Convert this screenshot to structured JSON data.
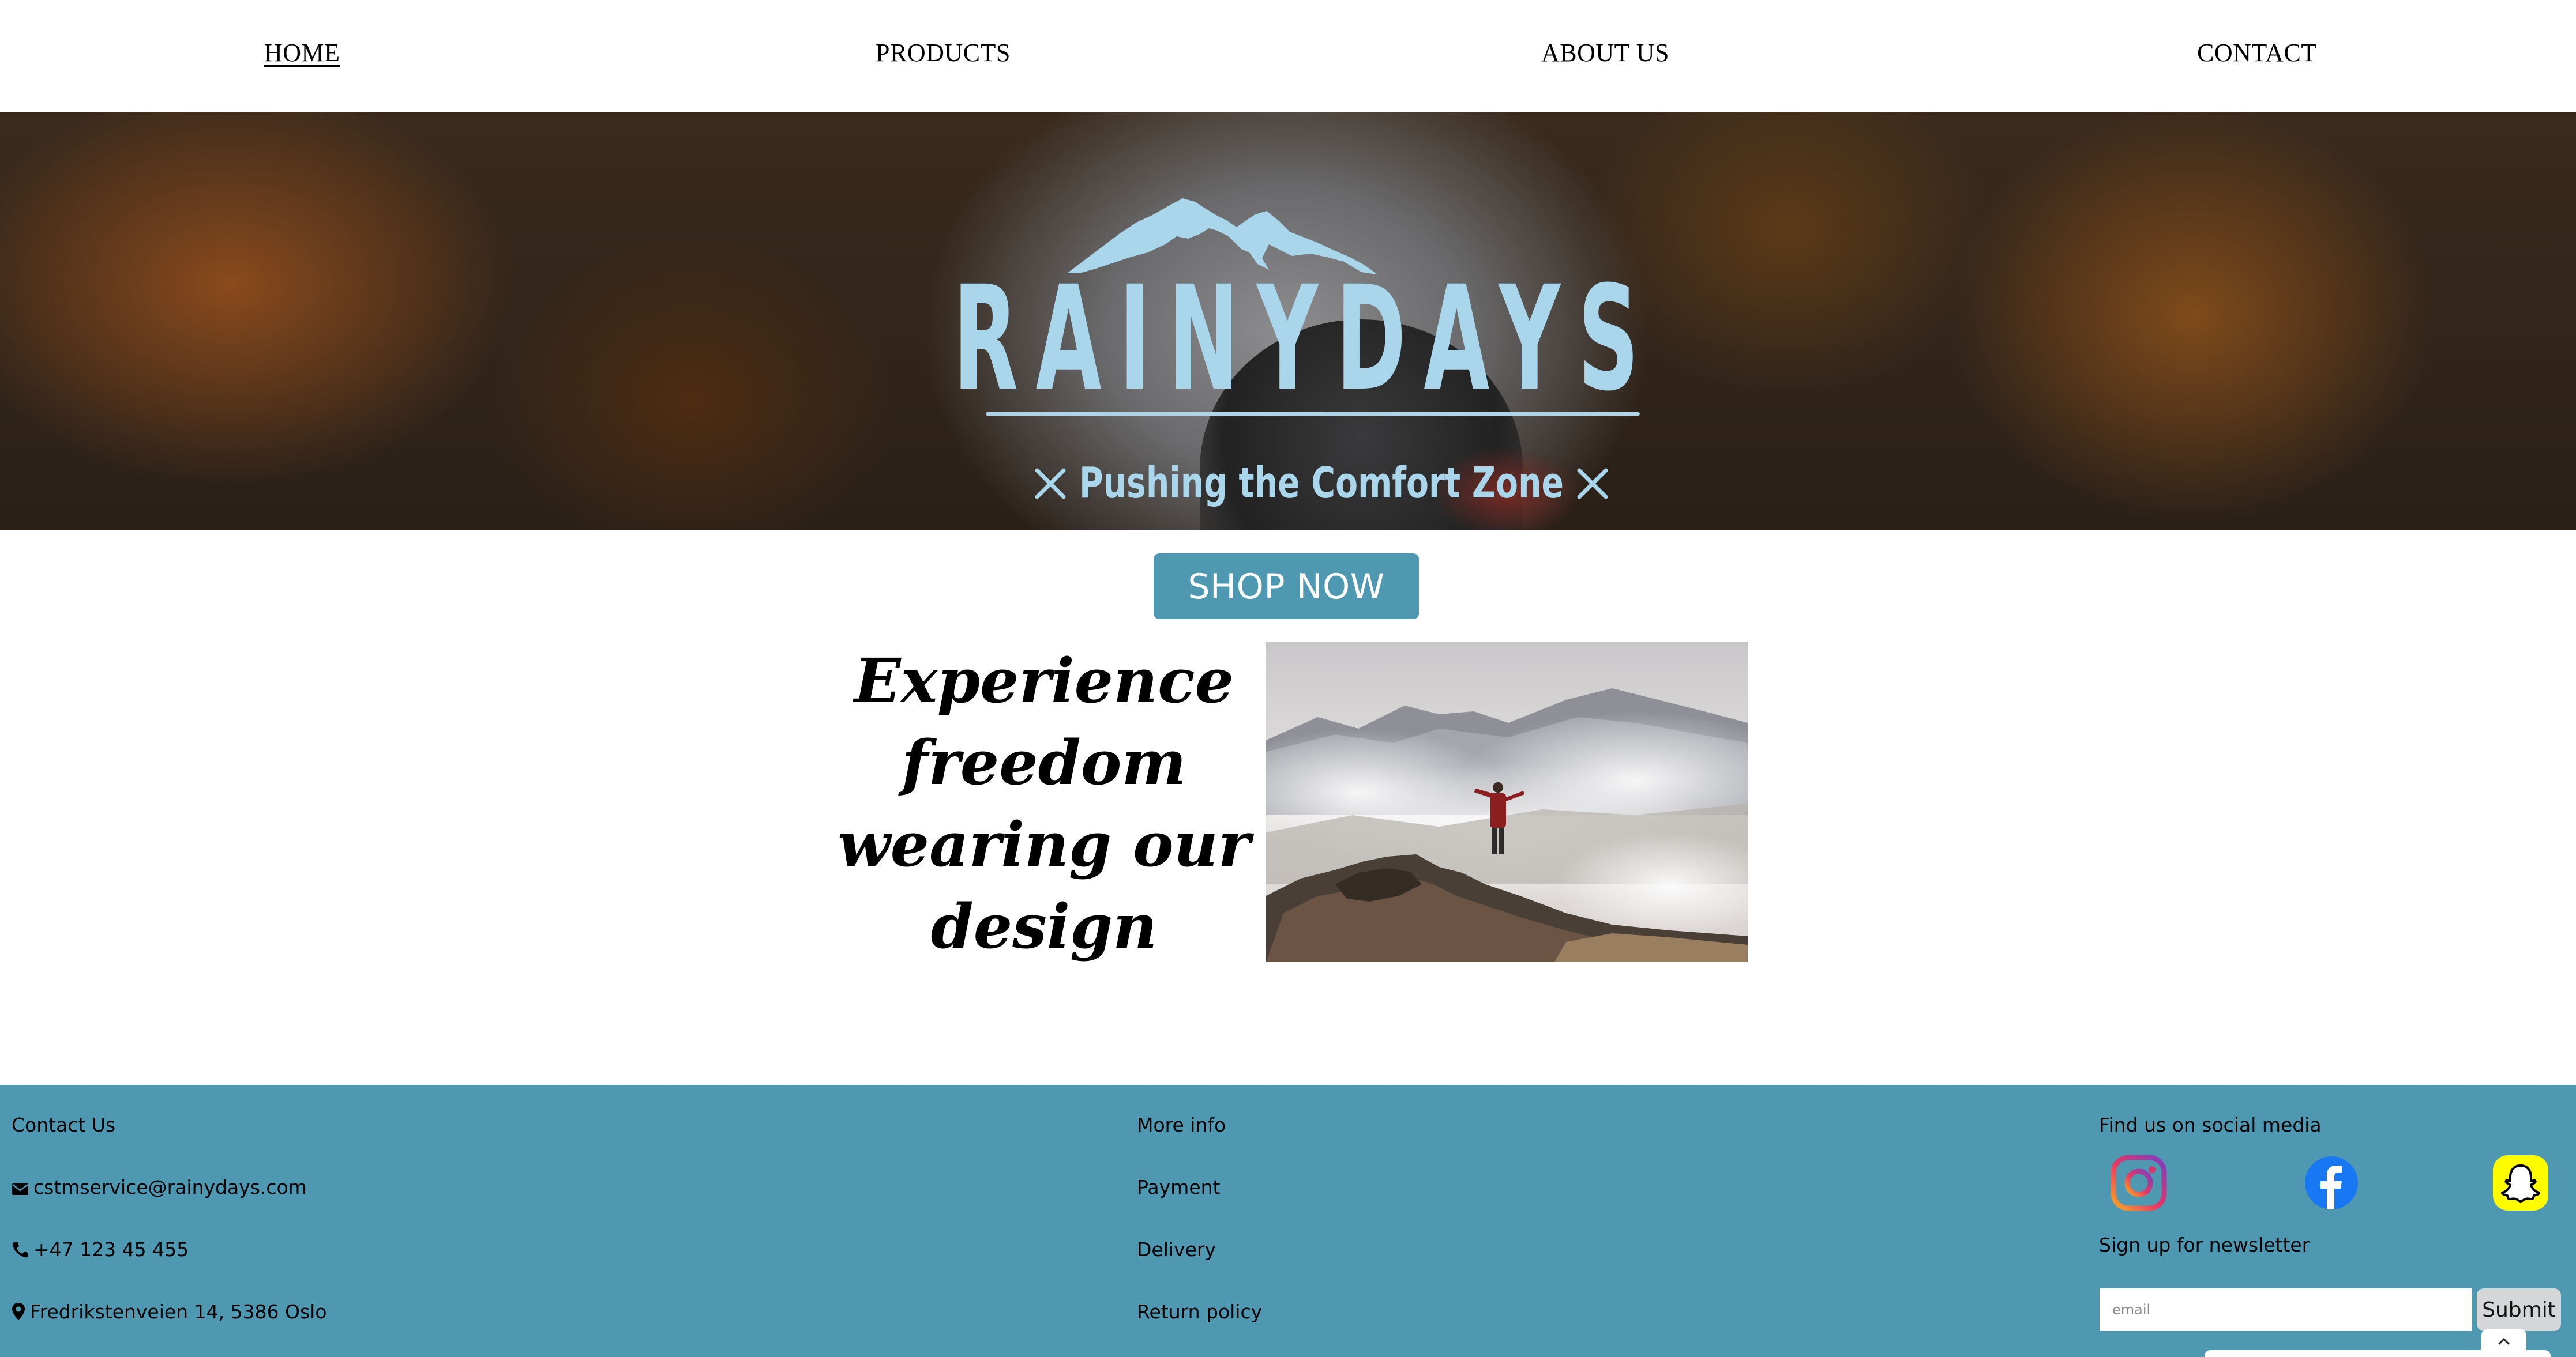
{
  "nav": {
    "items": [
      {
        "label": "HOME",
        "active": true
      },
      {
        "label": "PRODUCTS",
        "active": false
      },
      {
        "label": "ABOUT US",
        "active": false
      },
      {
        "label": "CONTACT",
        "active": false
      }
    ]
  },
  "hero": {
    "brand": "RAINYDAYS",
    "tagline": "Pushing the Comfort Zone",
    "logo_color": "#a9d6ea"
  },
  "shop_button": {
    "label": "SHOP NOW",
    "color": "#4f98b2"
  },
  "feature": {
    "headline_lines": [
      "Experience",
      "freedom",
      "wearing our",
      "design"
    ],
    "image_icon": "hiker-on-summit-image"
  },
  "footer": {
    "background": "#4f98b2",
    "contact": {
      "heading": "Contact Us",
      "email": "cstmservice@rainydays.com",
      "phone": "+47 123 45 455",
      "address": "Fredrikstenveien 14, 5386 Oslo",
      "email_icon": "envelope-icon",
      "phone_icon": "phone-icon",
      "address_icon": "map-marker-icon"
    },
    "more_info": {
      "heading": "More info",
      "links": [
        "Payment",
        "Delivery",
        "Return policy"
      ]
    },
    "social": {
      "heading": "Find us on social media",
      "icons": [
        "instagram-icon",
        "facebook-icon",
        "snapchat-icon"
      ],
      "newsletter_heading": "Sign up for newsletter",
      "email_placeholder": "email",
      "submit_label": "Submit",
      "scroll_top_icon": "chevron-up-icon"
    }
  }
}
